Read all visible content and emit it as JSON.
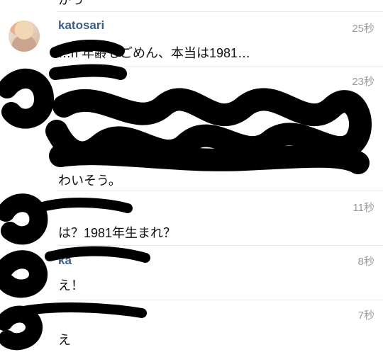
{
  "partial_text_top": "かっ",
  "comments": [
    {
      "username": "katosari",
      "time": "25秒",
      "text": "…n 年齢もごめん、本当は1981…"
    },
    {
      "username": "",
      "time": "23秒",
      "text_last": "わいそう。"
    },
    {
      "username": "",
      "time": "11秒",
      "text": "は？1981年生まれ？"
    },
    {
      "username": "ka",
      "time": "8秒",
      "text": "え！"
    },
    {
      "username": "",
      "time": "7秒",
      "text": "え"
    }
  ],
  "icons": {
    "avatar": "profile-photo"
  }
}
